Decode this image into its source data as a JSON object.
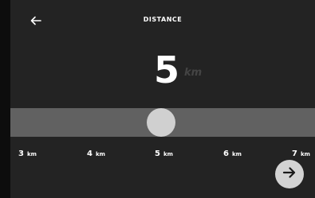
{
  "header": {
    "back_icon": "arrow-left-icon",
    "title": "DISTANCE"
  },
  "selector": {
    "value": "5",
    "unit": "km",
    "min": 3,
    "max": 7,
    "selected": 5
  },
  "scale": [
    {
      "value": "3",
      "unit": "km"
    },
    {
      "value": "4",
      "unit": "km"
    },
    {
      "value": "5",
      "unit": "km"
    },
    {
      "value": "6",
      "unit": "km"
    },
    {
      "value": "7",
      "unit": "km"
    }
  ],
  "footer": {
    "next_icon": "arrow-right-icon"
  },
  "colors": {
    "background": "#232323",
    "track": "#616161",
    "knob": "#d0d0d0",
    "unit_text": "#444444"
  }
}
